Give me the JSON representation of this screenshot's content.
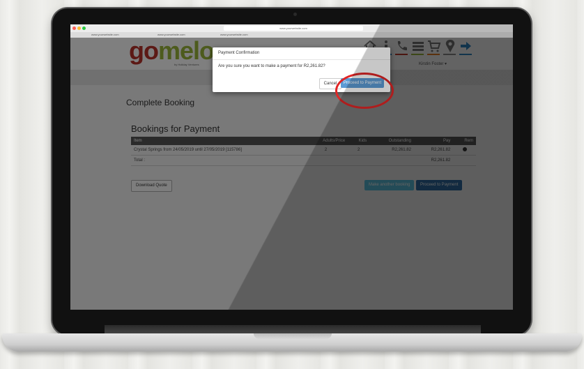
{
  "browser": {
    "url": "www.yourwebsite.com",
    "tabs": [
      "www.yourwebsite.com",
      "www.yourwebsite.com",
      "www.yourwebsite.com"
    ]
  },
  "site": {
    "logo": {
      "g": "go",
      "rest": "melo",
      "tagline": "by Holiday Ventures"
    },
    "user_menu": "Kirstin Foster ▾",
    "page_title": "Complete Booking",
    "section_title": "Bookings for Payment",
    "table": {
      "headers": [
        "Item",
        "Adults/Price",
        "Kids",
        "Outstanding",
        "Pay",
        "Rem"
      ],
      "rows": [
        {
          "item": "Crystal Springs from 24/05/2019 until 27/05/2019 [115786]",
          "adults": "2",
          "kids": "2",
          "outstanding": "R2,261.82",
          "pay": "R2,261.82"
        }
      ],
      "total_label": "Total :",
      "total_value": "R2,261.82"
    },
    "buttons": {
      "download_quote": "Download Quote",
      "make_another": "Make another booking",
      "proceed": "Proceed to Payment"
    }
  },
  "modal": {
    "title": "Payment Confirmation",
    "message": "Are you sure you want to make a payment for R2,261.82?",
    "cancel": "Cancel",
    "proceed": "Proceed to Payment"
  },
  "colors": {
    "logo_red": "#b8332b",
    "logo_green": "#9ab73a",
    "primary_button": "#5b9bd5",
    "highlight_circle": "#e02525"
  },
  "icons": [
    "home-icon",
    "info-icon",
    "phone-icon",
    "menu-icon",
    "cart-icon",
    "location-icon",
    "logout-icon"
  ]
}
